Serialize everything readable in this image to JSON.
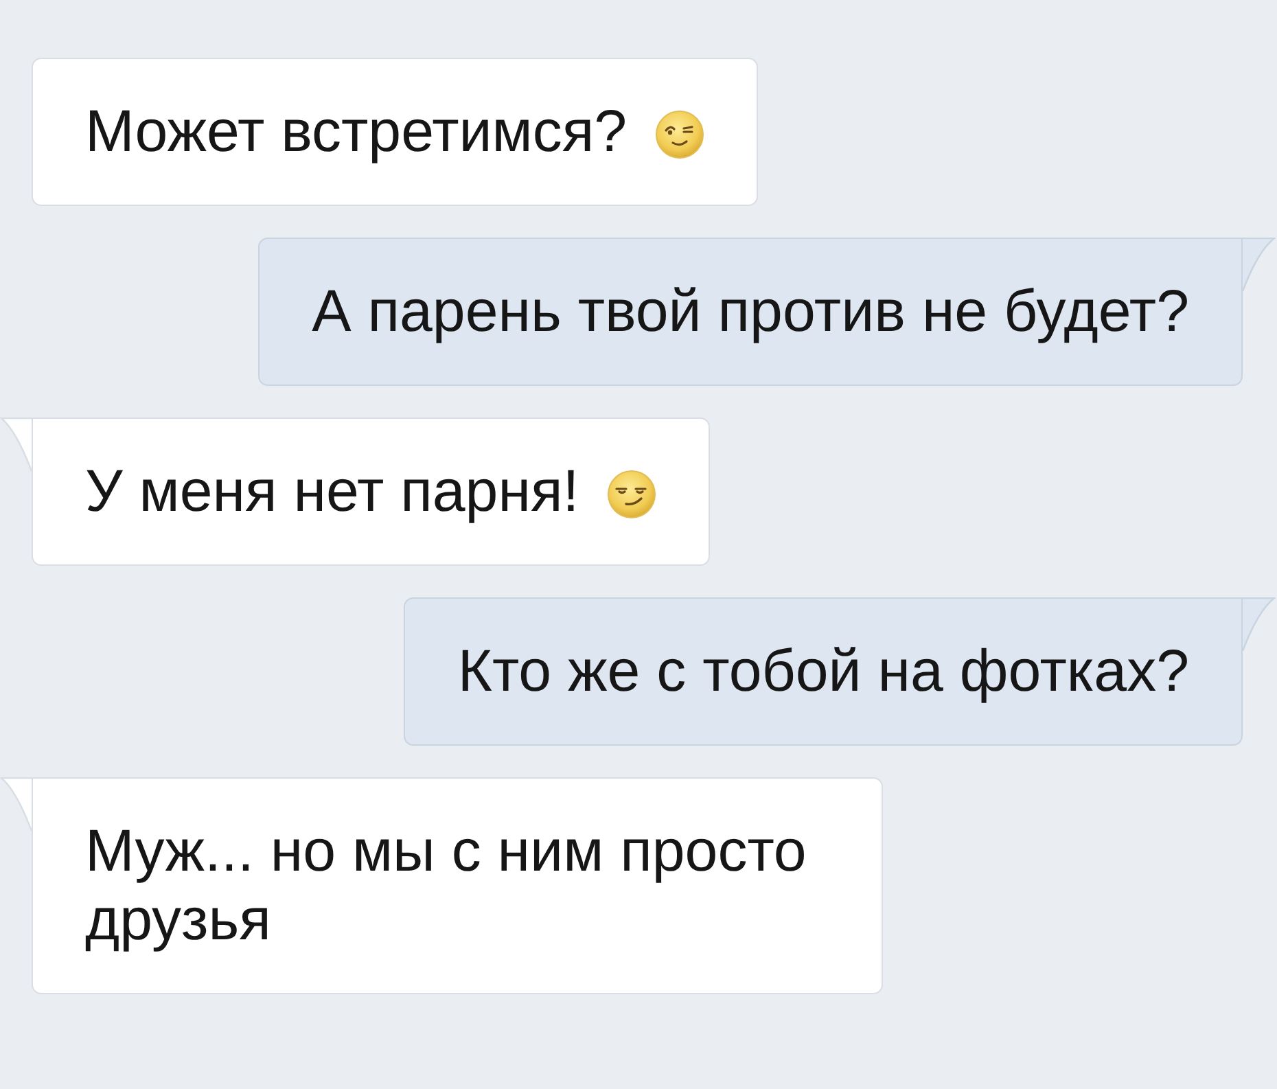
{
  "messages": [
    {
      "kind": "incoming",
      "tail": false,
      "text": "Может встретимся?",
      "emoji": {
        "kind": "wink"
      }
    },
    {
      "kind": "outgoing",
      "tail": true,
      "text": "А парень твой против не будет?"
    },
    {
      "kind": "incoming",
      "tail": true,
      "text": "У меня нет парня!",
      "emoji": {
        "kind": "smirk"
      }
    },
    {
      "kind": "outgoing",
      "tail": true,
      "text": "Кто же с тобой на фотках?"
    },
    {
      "kind": "incoming",
      "tail": true,
      "text": "Муж... но мы с ним просто друзья"
    }
  ]
}
